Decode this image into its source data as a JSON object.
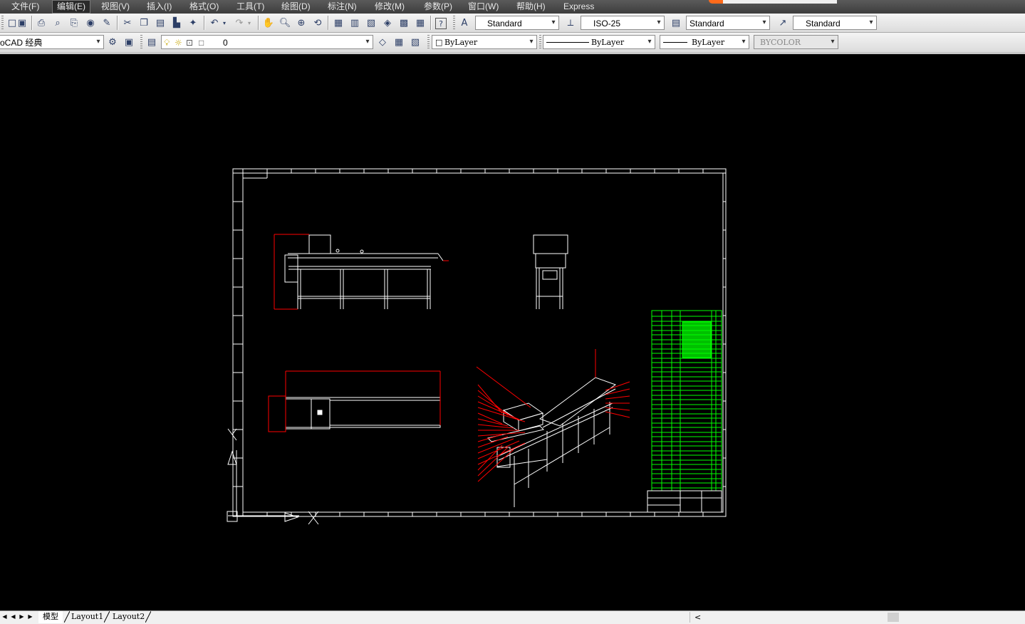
{
  "menu": {
    "items": [
      "文件(F)",
      "编辑(E)",
      "视图(V)",
      "插入(I)",
      "格式(O)",
      "工具(T)",
      "绘图(D)",
      "标注(N)",
      "修改(M)",
      "参数(P)",
      "窗口(W)",
      "帮助(H)",
      "Express"
    ],
    "active": "编辑(E)"
  },
  "toolbar1": {
    "text_style": "Standard",
    "dim_style": "ISO-25",
    "table_style": "Standard",
    "mleader_style": "Standard"
  },
  "toolbar2": {
    "workspace": "oCAD 经典",
    "layer": "0",
    "color": "ByLayer",
    "linetype": "ByLayer",
    "lineweight": "ByLayer",
    "plotstyle": "BYCOLOR"
  },
  "icons": {
    "toolbar1": [
      "new-icon",
      "save-icon",
      "print-icon",
      "plot-preview-icon",
      "publish-icon",
      "3dwf-icon",
      "etransmit-icon",
      "cut-icon",
      "copy-icon",
      "paste-icon",
      "match-properties-icon",
      "block-editor-icon",
      "undo-icon",
      "redo-icon",
      "pan-icon",
      "zoom-realtime-icon",
      "zoom-window-icon",
      "zoom-previous-icon",
      "properties-icon",
      "design-center-icon",
      "tool-palettes-icon",
      "sheet-set-icon",
      "markup-icon",
      "quickcalc-icon",
      "help-icon",
      "text-style-icon",
      "dim-style-icon",
      "table-style-icon",
      "mleader-style-icon"
    ],
    "toolbar2": [
      "workspace-settings-icon",
      "workspace-customize-icon",
      "layer-properties-icon",
      "layer-on-icon",
      "layer-freeze-icon",
      "layer-lock-icon",
      "make-current-layer-icon",
      "layer-states-icon",
      "layer-previous-icon"
    ]
  },
  "tabs": {
    "items": [
      "模型",
      "Layout1",
      "Layout2"
    ],
    "active": "模型"
  },
  "colors": {
    "canvas": "#000000",
    "drawing_lines": "#ffffff",
    "dimensions": "#ff0000",
    "title_block": "#00ff00"
  }
}
